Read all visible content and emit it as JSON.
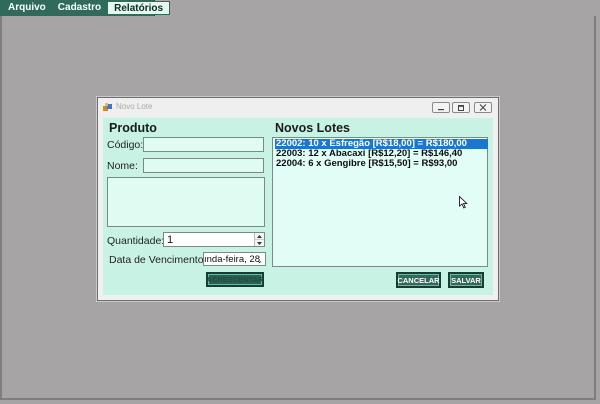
{
  "menu": {
    "items": [
      "Arquivo",
      "Cadastro",
      "Relatórios"
    ]
  },
  "window": {
    "title": "Novo Lote",
    "controls": [
      "minimize-icon",
      "maximize-icon",
      "close-icon"
    ]
  },
  "produto": {
    "section_title": "Produto",
    "codigo_label": "Código:",
    "codigo_value": "",
    "nome_label": "Nome:",
    "nome_value": "",
    "descricao_value": "",
    "quantidade_label": "Quantidade:",
    "quantidade_value": "1",
    "vencimento_label": "Data de Vencimento:",
    "vencimento_value": "ında-feira, 28",
    "acrescentar_label": "ACRESCENTAR"
  },
  "lotes": {
    "section_title": "Novos Lotes",
    "items": [
      "22002: 10 x Esfregão [R$18,00] = R$180,00",
      "22003: 12 x Abacaxi [R$12,20] = R$146,40",
      "22004: 6 x Gengibre [R$15,50] = R$93,00"
    ],
    "selected_index": 0,
    "cancelar_label": "CANCELAR",
    "salvar_label": "SALVAR"
  },
  "colors": {
    "menu_bg": "#2f6a5a",
    "client_bg": "#c8f2e4",
    "selection": "#1b76cd",
    "desktop": "#a6a4a5"
  }
}
